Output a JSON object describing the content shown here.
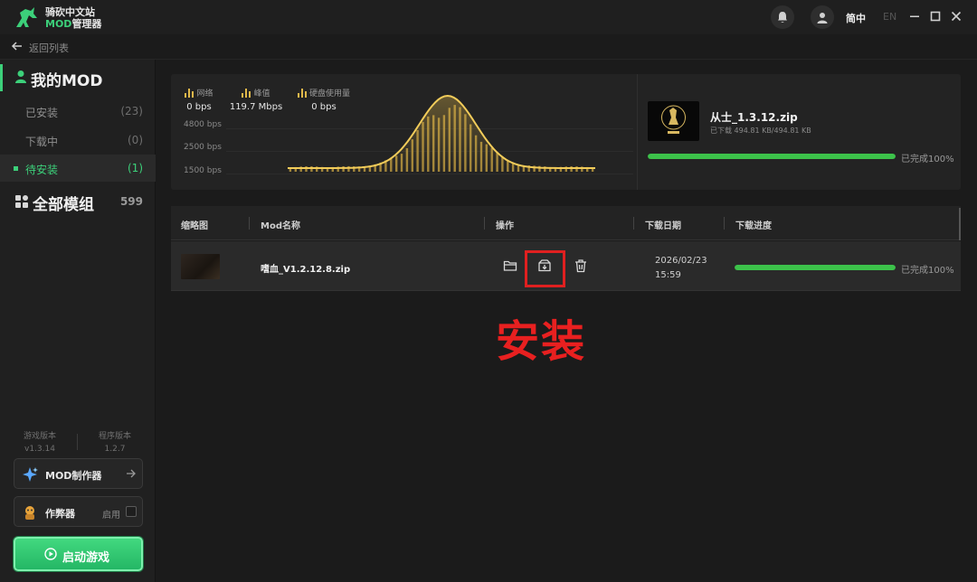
{
  "app": {
    "name_line1": "骑砍中文站",
    "name_mod": "MOD",
    "name_line2_rest": "管理器",
    "lang_active": "简中",
    "lang_inactive": "EN"
  },
  "nav": {
    "back_label": "返回列表"
  },
  "sidebar": {
    "my_mod_label": "我的MOD",
    "items": [
      {
        "label": "已安装",
        "count": "(23)",
        "active": false
      },
      {
        "label": "下载中",
        "count": "(0)",
        "active": false
      },
      {
        "label": "待安装",
        "count": "(1)",
        "active": true
      }
    ],
    "all_mods_label": "全部模组",
    "all_mods_count": "599",
    "game_version_label": "游戏版本",
    "game_version": "v1.3.14",
    "app_version_label": "程序版本",
    "app_version": "1.2.7",
    "mod_maker_label": "MOD制作器",
    "cheat_label": "作弊器",
    "cheat_enable_label": "启用",
    "play_label": "启动游戏"
  },
  "stats": {
    "network_label": "网络",
    "network_value": "0 bps",
    "peak_label": "峰值",
    "peak_value": "119.7 Mbps",
    "disk_label": "硬盘使用量",
    "disk_value": "0 bps",
    "y_ticks": [
      "4800 bps",
      "2500 bps",
      "1500 bps"
    ]
  },
  "current_download": {
    "filename": "从士_1.3.12.zip",
    "size_text": "已下载 494.81 KB/494.81 KB",
    "progress": 100,
    "status": "已完成100%"
  },
  "table": {
    "headers": [
      "缩略图",
      "Mod名称",
      "操作",
      "下载日期",
      "下载进度"
    ],
    "rows": [
      {
        "name": "嗜血_V1.2.12.8.zip",
        "date": "2026/02/23",
        "time": "15:59",
        "progress": 100,
        "status": "已完成100%"
      }
    ]
  },
  "annotation": "安装",
  "colors": {
    "accent": "#3cd07a",
    "progress": "#3cc24a",
    "chart": "#e0b84a",
    "highlight": "#e02020"
  }
}
